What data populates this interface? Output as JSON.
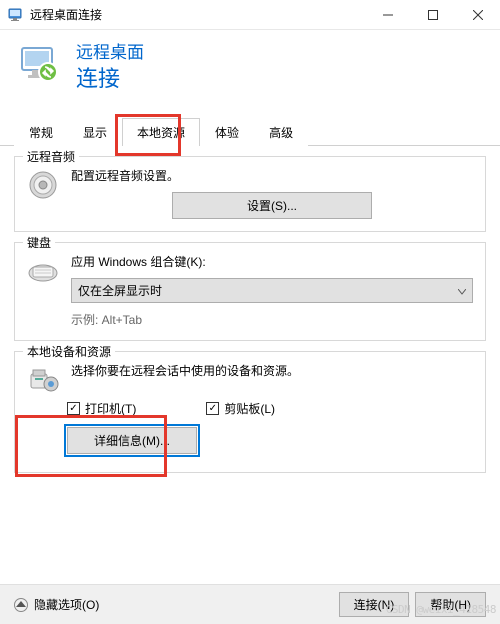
{
  "window": {
    "title": "远程桌面连接",
    "heading1": "远程桌面",
    "heading2": "连接"
  },
  "tabs": [
    "常规",
    "显示",
    "本地资源",
    "体验",
    "高级"
  ],
  "active_tab_index": 2,
  "groups": {
    "audio": {
      "title": "远程音频",
      "text": "配置远程音频设置。",
      "button": "设置(S)..."
    },
    "keyboard": {
      "title": "键盘",
      "text": "应用 Windows 组合键(K):",
      "select_value": "仅在全屏显示时",
      "hint": "示例: Alt+Tab"
    },
    "devices": {
      "title": "本地设备和资源",
      "text": "选择你要在远程会话中使用的设备和资源。",
      "check_printer": "打印机(T)",
      "check_clipboard": "剪贴板(L)",
      "details_button": "详细信息(M)..."
    }
  },
  "footer": {
    "hide_options": "隐藏选项(O)",
    "connect": "连接(N)",
    "help": "帮助(H)"
  },
  "watermark": "CSDN @weixi_418548"
}
